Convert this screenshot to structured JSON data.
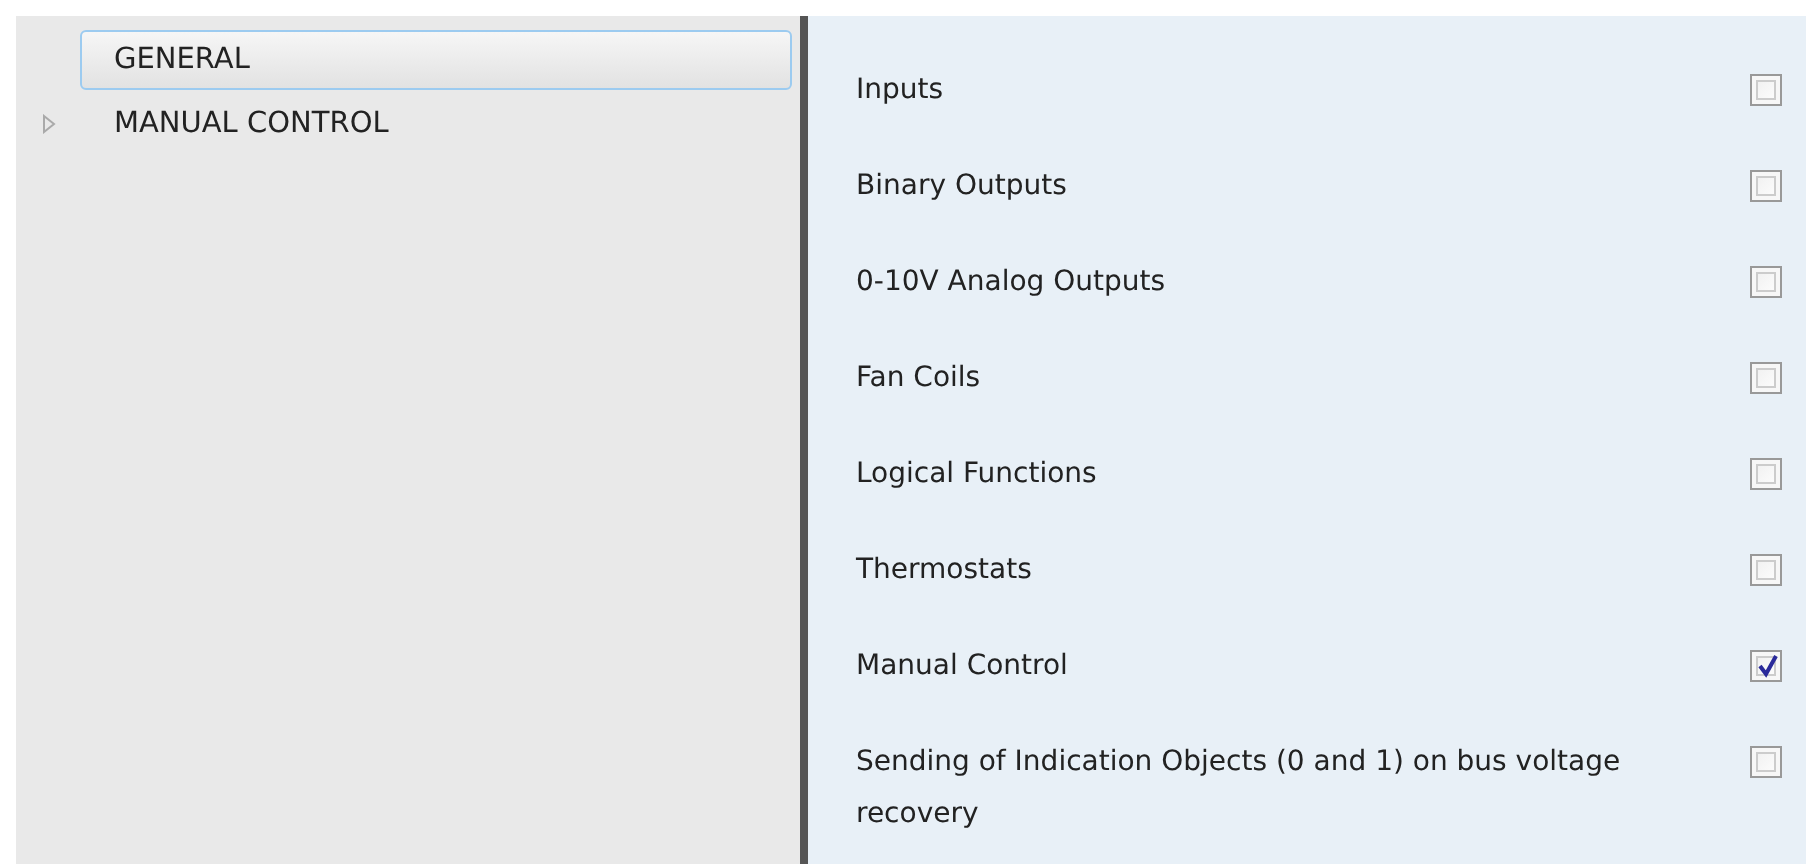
{
  "tree": {
    "items": [
      {
        "label": "GENERAL",
        "selected": true,
        "expandable": false
      },
      {
        "label": "MANUAL CONTROL",
        "selected": false,
        "expandable": true
      }
    ]
  },
  "settings": [
    {
      "label": "Inputs",
      "checked": false
    },
    {
      "label": "Binary Outputs",
      "checked": false
    },
    {
      "label": "0-10V Analog Outputs",
      "checked": false
    },
    {
      "label": "Fan Coils",
      "checked": false
    },
    {
      "label": "Logical Functions",
      "checked": false
    },
    {
      "label": "Thermostats",
      "checked": false
    },
    {
      "label": "Manual Control",
      "checked": true
    },
    {
      "label": "Sending of Indication Objects (0 and 1) on bus voltage recovery",
      "checked": false
    }
  ]
}
